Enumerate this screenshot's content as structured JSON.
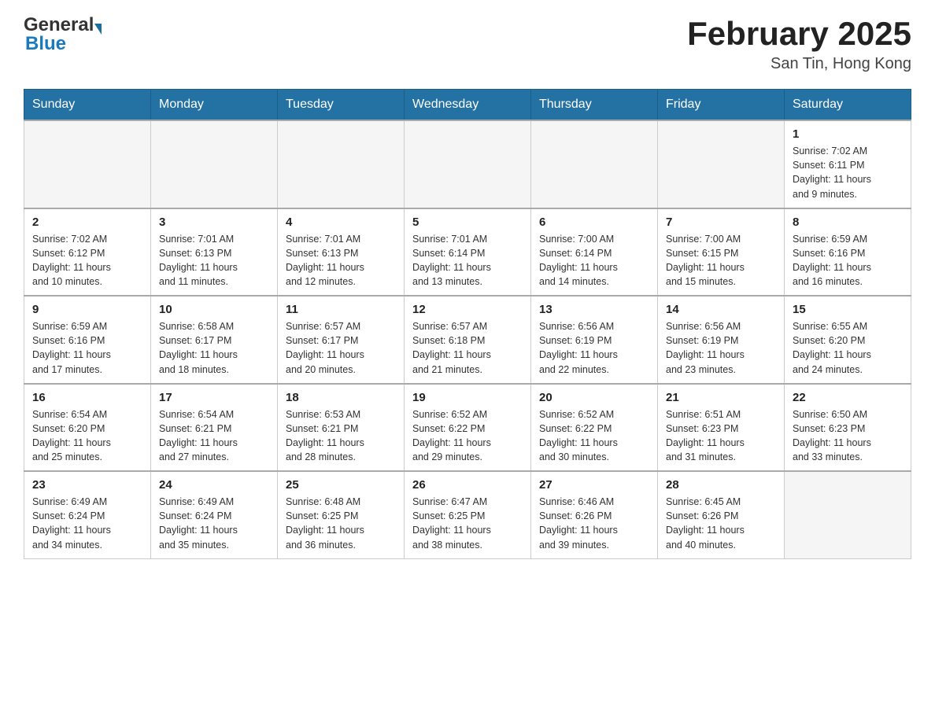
{
  "header": {
    "logo_general": "General",
    "logo_blue": "Blue",
    "month_title": "February 2025",
    "location": "San Tin, Hong Kong"
  },
  "weekdays": [
    "Sunday",
    "Monday",
    "Tuesday",
    "Wednesday",
    "Thursday",
    "Friday",
    "Saturday"
  ],
  "weeks": [
    {
      "days": [
        {
          "num": "",
          "info": ""
        },
        {
          "num": "",
          "info": ""
        },
        {
          "num": "",
          "info": ""
        },
        {
          "num": "",
          "info": ""
        },
        {
          "num": "",
          "info": ""
        },
        {
          "num": "",
          "info": ""
        },
        {
          "num": "1",
          "info": "Sunrise: 7:02 AM\nSunset: 6:11 PM\nDaylight: 11 hours\nand 9 minutes."
        }
      ]
    },
    {
      "days": [
        {
          "num": "2",
          "info": "Sunrise: 7:02 AM\nSunset: 6:12 PM\nDaylight: 11 hours\nand 10 minutes."
        },
        {
          "num": "3",
          "info": "Sunrise: 7:01 AM\nSunset: 6:13 PM\nDaylight: 11 hours\nand 11 minutes."
        },
        {
          "num": "4",
          "info": "Sunrise: 7:01 AM\nSunset: 6:13 PM\nDaylight: 11 hours\nand 12 minutes."
        },
        {
          "num": "5",
          "info": "Sunrise: 7:01 AM\nSunset: 6:14 PM\nDaylight: 11 hours\nand 13 minutes."
        },
        {
          "num": "6",
          "info": "Sunrise: 7:00 AM\nSunset: 6:14 PM\nDaylight: 11 hours\nand 14 minutes."
        },
        {
          "num": "7",
          "info": "Sunrise: 7:00 AM\nSunset: 6:15 PM\nDaylight: 11 hours\nand 15 minutes."
        },
        {
          "num": "8",
          "info": "Sunrise: 6:59 AM\nSunset: 6:16 PM\nDaylight: 11 hours\nand 16 minutes."
        }
      ]
    },
    {
      "days": [
        {
          "num": "9",
          "info": "Sunrise: 6:59 AM\nSunset: 6:16 PM\nDaylight: 11 hours\nand 17 minutes."
        },
        {
          "num": "10",
          "info": "Sunrise: 6:58 AM\nSunset: 6:17 PM\nDaylight: 11 hours\nand 18 minutes."
        },
        {
          "num": "11",
          "info": "Sunrise: 6:57 AM\nSunset: 6:17 PM\nDaylight: 11 hours\nand 20 minutes."
        },
        {
          "num": "12",
          "info": "Sunrise: 6:57 AM\nSunset: 6:18 PM\nDaylight: 11 hours\nand 21 minutes."
        },
        {
          "num": "13",
          "info": "Sunrise: 6:56 AM\nSunset: 6:19 PM\nDaylight: 11 hours\nand 22 minutes."
        },
        {
          "num": "14",
          "info": "Sunrise: 6:56 AM\nSunset: 6:19 PM\nDaylight: 11 hours\nand 23 minutes."
        },
        {
          "num": "15",
          "info": "Sunrise: 6:55 AM\nSunset: 6:20 PM\nDaylight: 11 hours\nand 24 minutes."
        }
      ]
    },
    {
      "days": [
        {
          "num": "16",
          "info": "Sunrise: 6:54 AM\nSunset: 6:20 PM\nDaylight: 11 hours\nand 25 minutes."
        },
        {
          "num": "17",
          "info": "Sunrise: 6:54 AM\nSunset: 6:21 PM\nDaylight: 11 hours\nand 27 minutes."
        },
        {
          "num": "18",
          "info": "Sunrise: 6:53 AM\nSunset: 6:21 PM\nDaylight: 11 hours\nand 28 minutes."
        },
        {
          "num": "19",
          "info": "Sunrise: 6:52 AM\nSunset: 6:22 PM\nDaylight: 11 hours\nand 29 minutes."
        },
        {
          "num": "20",
          "info": "Sunrise: 6:52 AM\nSunset: 6:22 PM\nDaylight: 11 hours\nand 30 minutes."
        },
        {
          "num": "21",
          "info": "Sunrise: 6:51 AM\nSunset: 6:23 PM\nDaylight: 11 hours\nand 31 minutes."
        },
        {
          "num": "22",
          "info": "Sunrise: 6:50 AM\nSunset: 6:23 PM\nDaylight: 11 hours\nand 33 minutes."
        }
      ]
    },
    {
      "days": [
        {
          "num": "23",
          "info": "Sunrise: 6:49 AM\nSunset: 6:24 PM\nDaylight: 11 hours\nand 34 minutes."
        },
        {
          "num": "24",
          "info": "Sunrise: 6:49 AM\nSunset: 6:24 PM\nDaylight: 11 hours\nand 35 minutes."
        },
        {
          "num": "25",
          "info": "Sunrise: 6:48 AM\nSunset: 6:25 PM\nDaylight: 11 hours\nand 36 minutes."
        },
        {
          "num": "26",
          "info": "Sunrise: 6:47 AM\nSunset: 6:25 PM\nDaylight: 11 hours\nand 38 minutes."
        },
        {
          "num": "27",
          "info": "Sunrise: 6:46 AM\nSunset: 6:26 PM\nDaylight: 11 hours\nand 39 minutes."
        },
        {
          "num": "28",
          "info": "Sunrise: 6:45 AM\nSunset: 6:26 PM\nDaylight: 11 hours\nand 40 minutes."
        },
        {
          "num": "",
          "info": ""
        }
      ]
    }
  ]
}
